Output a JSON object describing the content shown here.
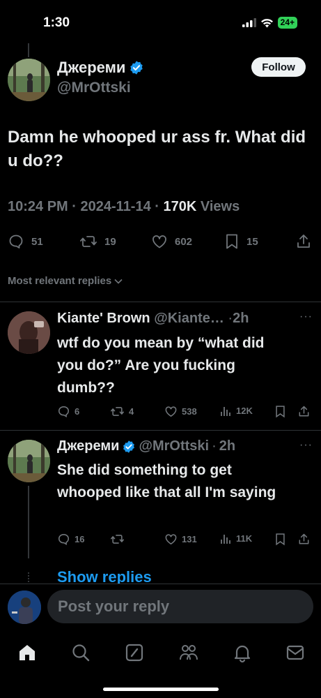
{
  "status_bar": {
    "time": "1:30",
    "battery": "24+"
  },
  "tweet": {
    "display_name": "Джереми",
    "handle": "@MrOttski",
    "follow_label": "Follow",
    "text": "Damn he whooped ur ass fr. What did u do??",
    "time": "10:24 PM",
    "sep1": "·",
    "date": "2024-11-14",
    "sep2": "·",
    "views_count": "170K",
    "views_label": "Views",
    "stats": {
      "replies": "51",
      "reposts": "19",
      "likes": "602",
      "bookmarks": "15"
    }
  },
  "sort_label": "Most relevant replies",
  "replies": [
    {
      "display_name": "Kiante' Brown",
      "handle": "@Kiante…",
      "sep": "·",
      "age": "2h",
      "more": "···",
      "text": "wtf do you mean by “what did you do?” Are you fucking dumb??",
      "stats": {
        "replies": "6",
        "reposts": "4",
        "likes": "538",
        "views": "12K"
      }
    },
    {
      "display_name": "Джереми",
      "handle": "@MrOttski",
      "sep": "·",
      "age": "2h",
      "more": "···",
      "text": "She did something to get whooped like that all I'm saying",
      "stats": {
        "replies": "16",
        "reposts": "",
        "likes": "131",
        "views": "11K"
      }
    }
  ],
  "show_replies_label": "Show replies",
  "reply_placeholder": "Post your reply",
  "icons": {
    "verified": "verified-badge-icon",
    "reply": "comment-icon",
    "repost": "repost-icon",
    "like": "heart-icon",
    "bookmark": "bookmark-icon",
    "share": "share-icon",
    "views": "bar-chart-icon",
    "home": "home-icon",
    "search": "search-icon",
    "grok": "grok-icon",
    "communities": "communities-icon",
    "notifications": "bell-icon",
    "messages": "mail-icon"
  },
  "colors": {
    "accent": "#1d9bf0",
    "background": "#000000",
    "muted": "#71767b",
    "text": "#e7e9ea"
  }
}
